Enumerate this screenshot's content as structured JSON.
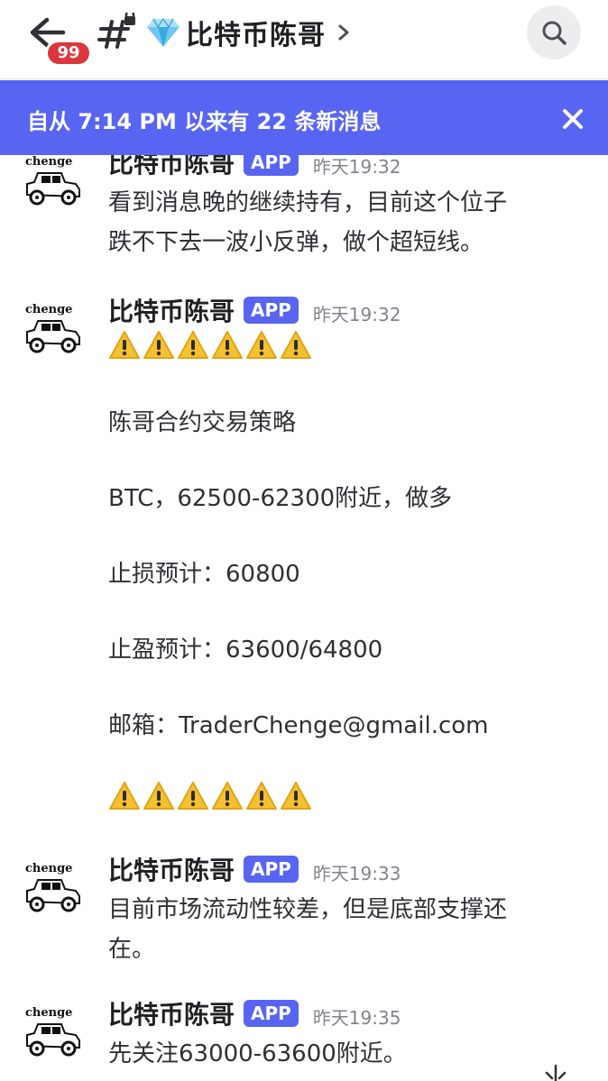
{
  "header": {
    "unread_count": "99",
    "channel_title": "比特币陈哥",
    "icons": {
      "back": "arrow-left-icon",
      "channel": "locked-hash-icon",
      "gem": "gem-emoji",
      "chevron": "chevron-right-icon",
      "search": "search-icon"
    }
  },
  "banner": {
    "text": "自从 7:14 PM 以来有 22 条新消息",
    "close_icon": "close-icon",
    "color": "#5865f2"
  },
  "messages": [
    {
      "avatar_text": "chenge",
      "author": "比特币陈哥",
      "tag": "APP",
      "time": "昨天19:32",
      "lines": [
        "看到消息晚的继续持有，目前这个位子",
        "跌不下去一波小反弹，做个超短线。"
      ]
    },
    {
      "avatar_text": "chenge",
      "author": "比特币陈哥",
      "tag": "APP",
      "time": "昨天19:32",
      "lines": [
        "陈哥合约交易策略",
        "BTC，62500-62300附近，做多",
        "止损预计：60800",
        "止盈预计：63600/64800",
        "邮箱：TraderChenge@gmail.com"
      ],
      "warning_emoji": "warning-emoji"
    },
    {
      "avatar_text": "chenge",
      "author": "比特币陈哥",
      "tag": "APP",
      "time": "昨天19:33",
      "lines": [
        "目前市场流动性较差，但是底部支撑还",
        "在。"
      ]
    },
    {
      "avatar_text": "chenge",
      "author": "比特币陈哥",
      "tag": "APP",
      "time": "昨天19:35",
      "lines": [
        "先关注63000-63600附近。"
      ]
    }
  ],
  "colors": {
    "accent": "#5865f2",
    "badge": "#da373c",
    "warning": "#f6c033"
  }
}
